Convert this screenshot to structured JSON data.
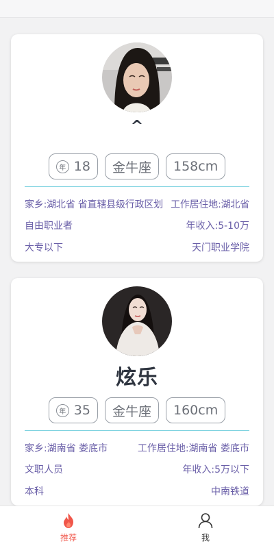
{
  "feed": {
    "cards": [
      {
        "nickname": "^",
        "age": "18",
        "age_icon_text": "年",
        "zodiac": "金牛座",
        "height": "158cm",
        "hometown": "家乡:湖北省 省直辖县级行政区划",
        "residence": "工作居住地:湖北省",
        "occupation": "自由职业者",
        "income": "年收入:5-10万",
        "education": "大专以下",
        "school": "天门职业学院"
      },
      {
        "nickname": "炫乐",
        "age": "35",
        "age_icon_text": "年",
        "zodiac": "金牛座",
        "height": "160cm",
        "hometown": "家乡:湖南省 娄底市",
        "residence": "工作居住地:湖南省 娄底市",
        "occupation": "文职人员",
        "income": "年收入:5万以下",
        "education": "本科",
        "school": "中南铁道"
      }
    ]
  },
  "tabbar": {
    "tabs": [
      {
        "label": "推荐",
        "icon": "flame-icon",
        "active": true
      },
      {
        "label": "我",
        "icon": "person-icon",
        "active": false
      }
    ]
  },
  "colors": {
    "accent": "#f0564a",
    "info_text": "#6a5fa8",
    "divider": "#7fd3e0"
  }
}
